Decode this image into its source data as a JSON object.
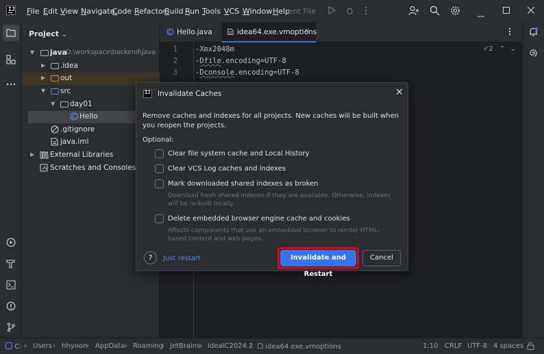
{
  "titlebar": {
    "menu": [
      {
        "label": "File",
        "u": "F",
        "rest": "ile"
      },
      {
        "label": "Edit",
        "u": "E",
        "rest": "dit"
      },
      {
        "label": "View",
        "u": "V",
        "rest": "iew"
      },
      {
        "label": "Navigate",
        "u": "N",
        "rest": "avigate"
      },
      {
        "label": "Code",
        "u": "C",
        "rest": "ode"
      },
      {
        "label": "Refactor",
        "u": "R",
        "rest": "efactor"
      },
      {
        "label": "Build",
        "u": "B",
        "rest": "uild"
      },
      {
        "label": "Run",
        "u": "R",
        "rest": "un"
      },
      {
        "label": "Tools",
        "u": "T",
        "rest": "ools"
      },
      {
        "label": "VCS",
        "u": "V",
        "rest": "CS"
      },
      {
        "label": "Window",
        "u": "W",
        "rest": "indow"
      },
      {
        "label": "Help",
        "u": "H",
        "rest": "elp"
      }
    ],
    "run_config": "ent File",
    "logo_text": "IJ"
  },
  "project": {
    "title": "Project",
    "tree": [
      {
        "label": "java",
        "sub": "D:\\workspace\\backend\\java"
      },
      {
        "label": ".idea"
      },
      {
        "label": "out"
      },
      {
        "label": "src"
      },
      {
        "label": "day01"
      },
      {
        "label": "Hello"
      },
      {
        "label": ".gitignore"
      },
      {
        "label": "java.iml"
      },
      {
        "label": "External Libraries"
      },
      {
        "label": "Scratches and Consoles"
      }
    ]
  },
  "editor": {
    "tabs": [
      {
        "label": "Hello.java"
      },
      {
        "label": "idea64.exe.vmoptions"
      }
    ],
    "inspection_count": "2",
    "lines": [
      {
        "num": "1",
        "text": "-Xmx2048m"
      },
      {
        "num": "2",
        "pre": "-",
        "under": "Dfile",
        "post": ".encoding=UTF-8"
      },
      {
        "num": "3",
        "pre": "-",
        "under": "Dconsole",
        "post": ".encoding=UTF-8"
      }
    ]
  },
  "dialog": {
    "title": "Invalidate Caches",
    "description": "Remove caches and indexes for all projects. New caches will be built when you reopen the projects.",
    "optional_label": "Optional:",
    "options": [
      {
        "label": "Clear file system cache and Local History",
        "checked": false
      },
      {
        "label": "Clear VCS Log caches and indexes",
        "checked": false
      },
      {
        "label": "Mark downloaded shared indexes as broken",
        "checked": false,
        "hint": "Download fresh shared indexes if they are available. Otherwise, indexes will be re-built locally."
      },
      {
        "label": "Delete embedded browser engine cache and cookies",
        "checked": false,
        "hint": "Affects components that use an embedded browser to render HTML-based content and web pages."
      }
    ],
    "help_label": "?",
    "just_restart": "Just restart",
    "primary_button": "Invalidate and Restart",
    "cancel_button": "Cancel"
  },
  "statusbar": {
    "breadcrumbs": [
      "C:",
      "Users",
      "hhyoon",
      "AppData",
      "Roaming",
      "JetBrains",
      "IdeaIC2024.2",
      "idea64.exe.vmoptions"
    ],
    "position": "1:10",
    "line_sep": "CRLF",
    "encoding": "UTF-8",
    "indent": "4 spaces"
  },
  "colors": {
    "accent": "#3574f0",
    "highlight": "#e8000b",
    "link": "#548af7",
    "background": "#1e1f22",
    "panel": "#2b2d30"
  }
}
